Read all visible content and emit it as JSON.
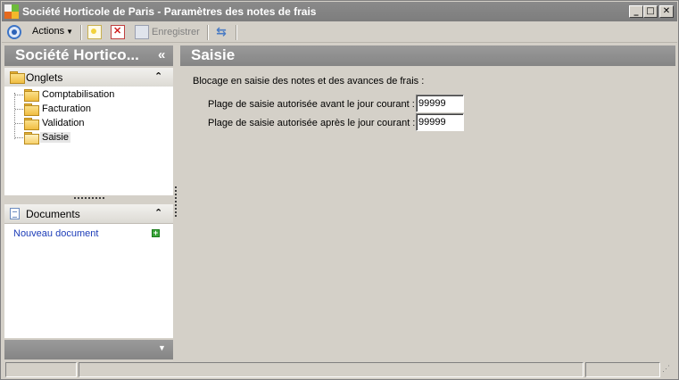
{
  "window": {
    "title": "Société Horticole de Paris - Paramètres des notes de frais",
    "controls": {
      "minimize": "_",
      "maximize": "□",
      "close": "✕"
    }
  },
  "toolbar": {
    "actions_label": "Actions",
    "save_label": "Enregistrer"
  },
  "left_panel": {
    "title": "Société Hortico...",
    "collapse_glyph": "«",
    "tabs_group": {
      "label": "Onglets",
      "collapse_glyph": "⌃",
      "items": [
        {
          "label": "Comptabilisation"
        },
        {
          "label": "Facturation"
        },
        {
          "label": "Validation"
        },
        {
          "label": "Saisie",
          "selected": true
        }
      ]
    },
    "documents_group": {
      "label": "Documents",
      "collapse_glyph": "⌃",
      "new_document_label": "Nouveau document"
    }
  },
  "main": {
    "title": "Saisie",
    "section_label": "Blocage en saisie des notes et des avances de frais :",
    "fields": [
      {
        "label": "Plage de saisie autorisée avant le jour courant :",
        "value": "99999"
      },
      {
        "label": "Plage de saisie autorisée après le jour courant :",
        "value": "99999"
      }
    ]
  },
  "icons": {
    "nav": "back-forward-icon",
    "new": "new-document-icon",
    "delete": "delete-icon",
    "save": "save-icon",
    "refresh": "refresh-icon"
  },
  "colors": {
    "header_gray": "#8f8f8f",
    "window_bg": "#d4d0c8",
    "link_blue": "#1c3cb8"
  }
}
